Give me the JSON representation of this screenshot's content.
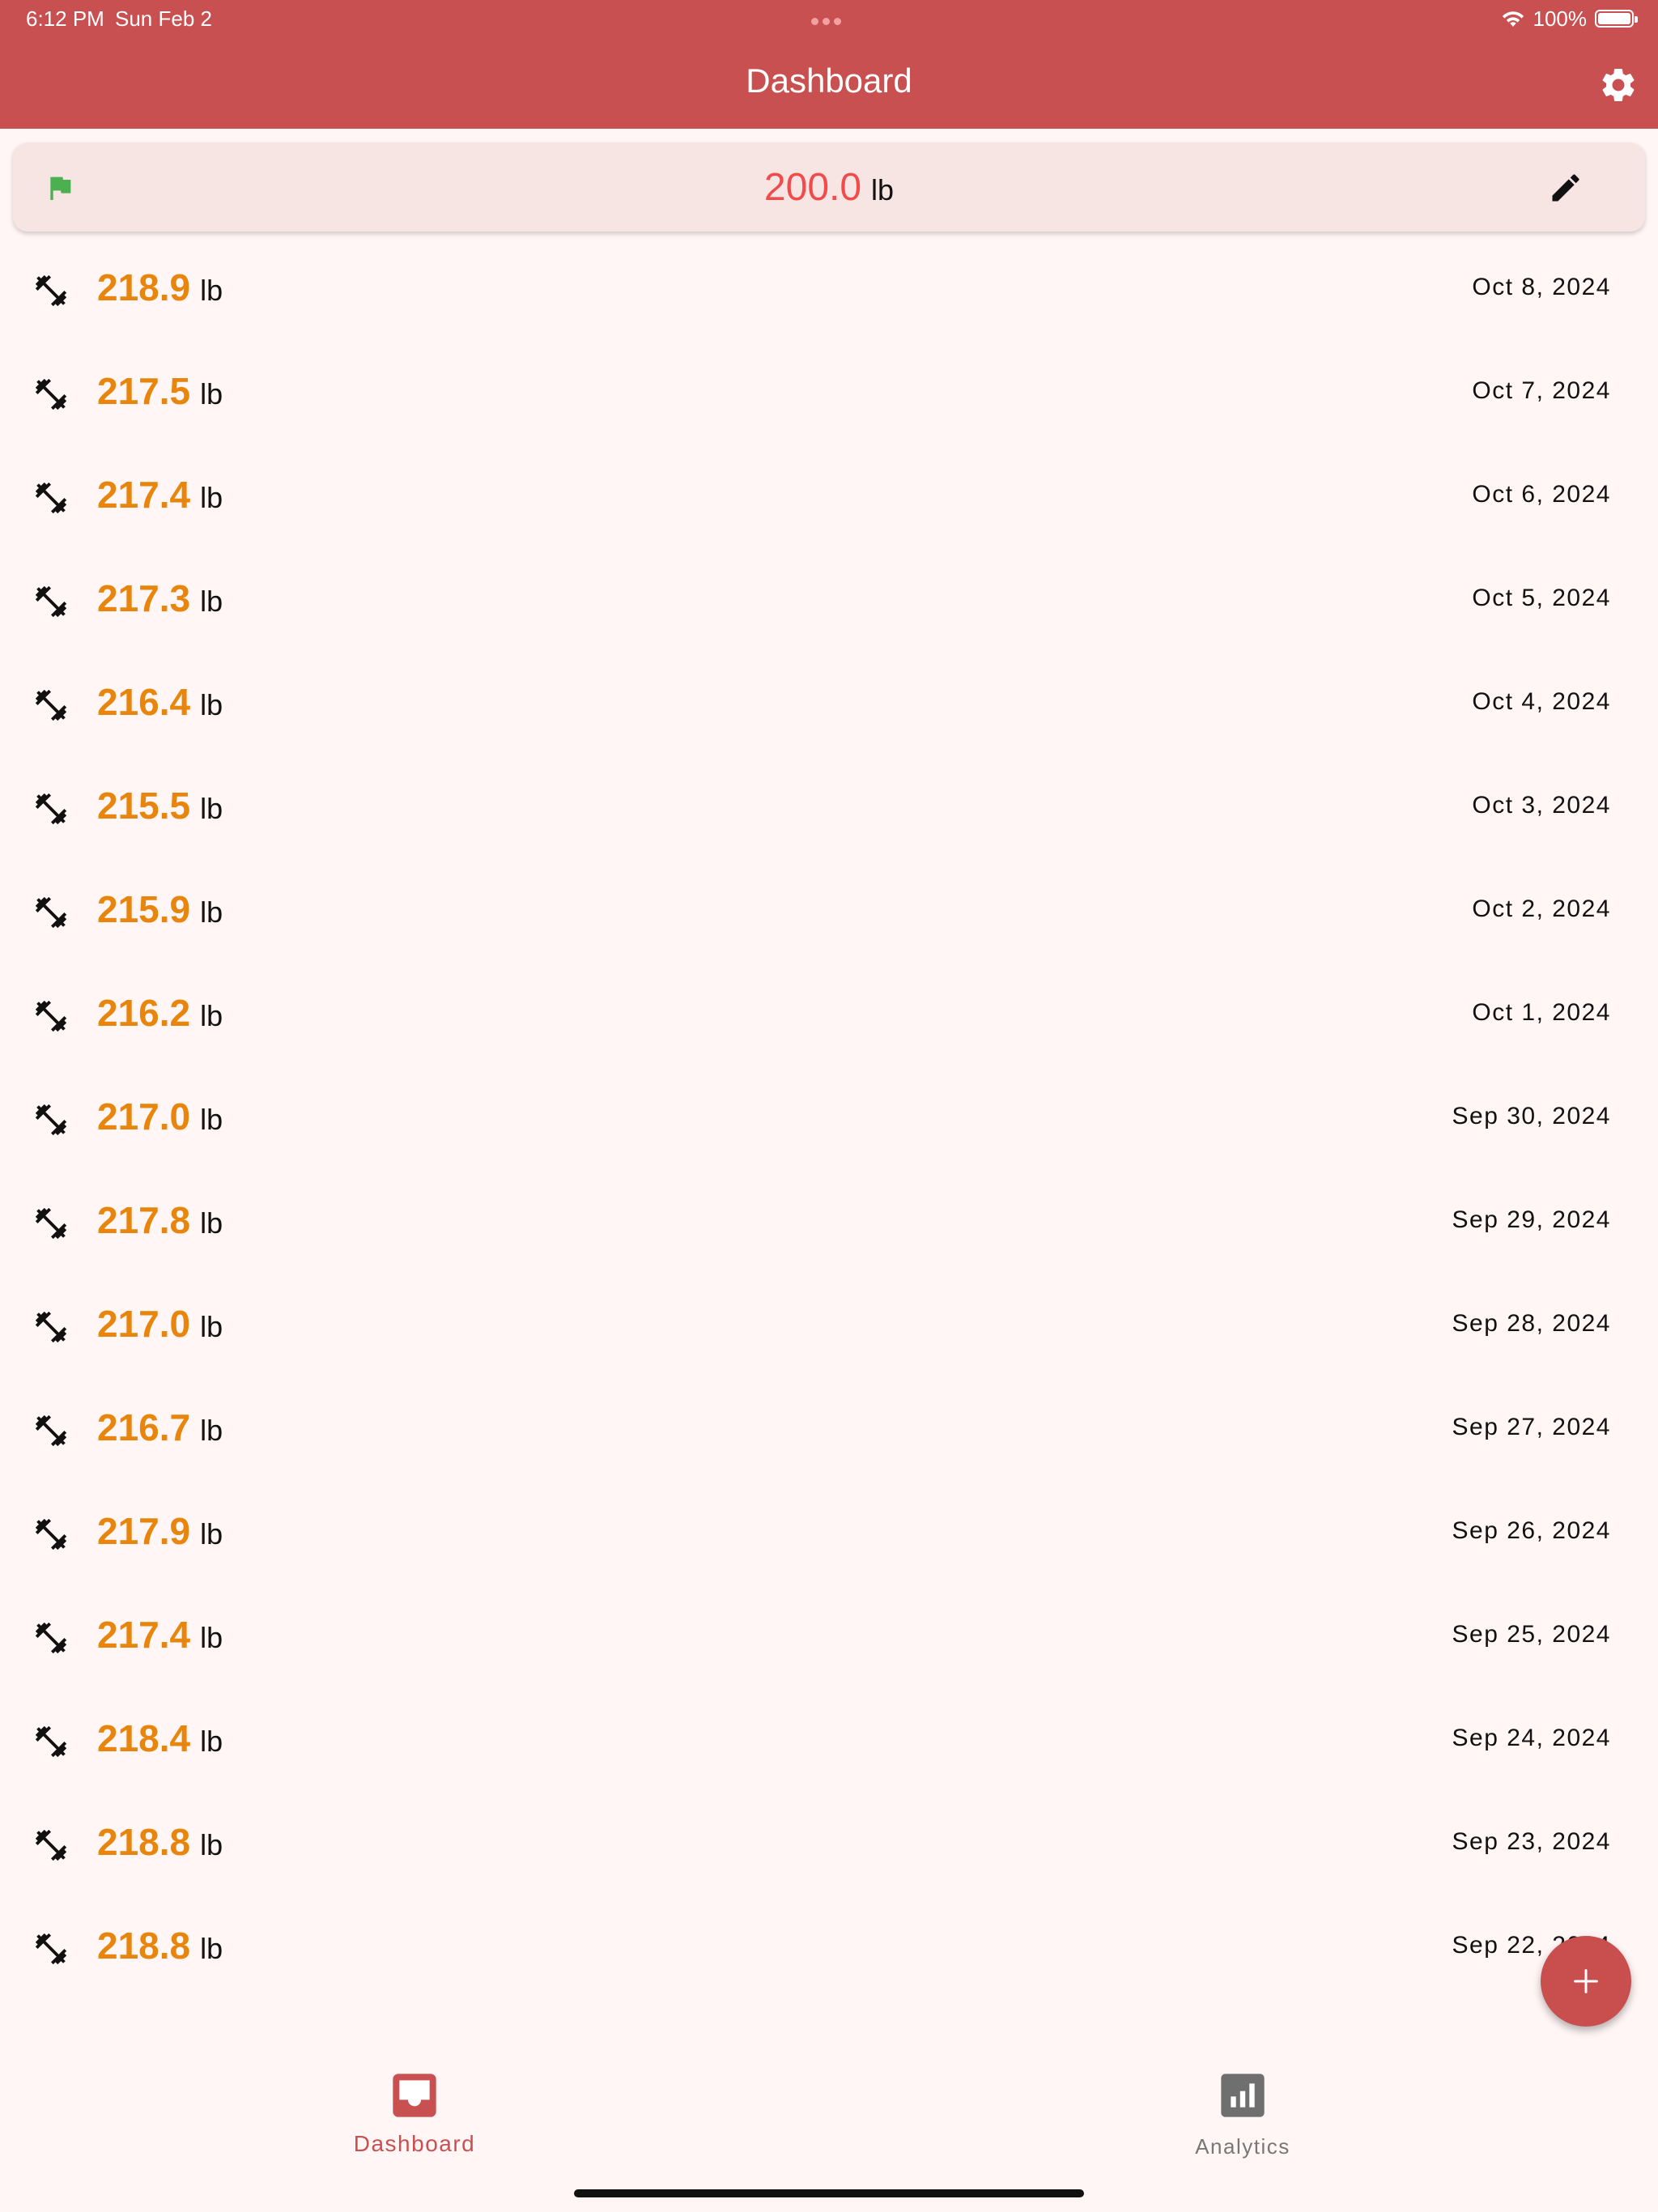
{
  "status_bar": {
    "time": "6:12 PM",
    "date": "Sun Feb 2",
    "battery": "100%"
  },
  "header": {
    "title": "Dashboard"
  },
  "goal": {
    "value": "200.0",
    "unit": "lb"
  },
  "entries": [
    {
      "weight": "218.9",
      "unit": "lb",
      "date": "Oct 8, 2024"
    },
    {
      "weight": "217.5",
      "unit": "lb",
      "date": "Oct 7, 2024"
    },
    {
      "weight": "217.4",
      "unit": "lb",
      "date": "Oct 6, 2024"
    },
    {
      "weight": "217.3",
      "unit": "lb",
      "date": "Oct 5, 2024"
    },
    {
      "weight": "216.4",
      "unit": "lb",
      "date": "Oct 4, 2024"
    },
    {
      "weight": "215.5",
      "unit": "lb",
      "date": "Oct 3, 2024"
    },
    {
      "weight": "215.9",
      "unit": "lb",
      "date": "Oct 2, 2024"
    },
    {
      "weight": "216.2",
      "unit": "lb",
      "date": "Oct 1, 2024"
    },
    {
      "weight": "217.0",
      "unit": "lb",
      "date": "Sep 30, 2024"
    },
    {
      "weight": "217.8",
      "unit": "lb",
      "date": "Sep 29, 2024"
    },
    {
      "weight": "217.0",
      "unit": "lb",
      "date": "Sep 28, 2024"
    },
    {
      "weight": "216.7",
      "unit": "lb",
      "date": "Sep 27, 2024"
    },
    {
      "weight": "217.9",
      "unit": "lb",
      "date": "Sep 26, 2024"
    },
    {
      "weight": "217.4",
      "unit": "lb",
      "date": "Sep 25, 2024"
    },
    {
      "weight": "218.4",
      "unit": "lb",
      "date": "Sep 24, 2024"
    },
    {
      "weight": "218.8",
      "unit": "lb",
      "date": "Sep 23, 2024"
    },
    {
      "weight": "218.8",
      "unit": "lb",
      "date": "Sep 22, 2024"
    }
  ],
  "bottom_nav": {
    "dashboard_label": "Dashboard",
    "analytics_label": "Analytics"
  },
  "colors": {
    "accent": "#c85050",
    "weight": "#e8850c",
    "goal": "#f24b4b",
    "flag": "#4caf50"
  },
  "icons": {
    "entry": "fitness-dumbbell-icon",
    "goal": "flag-icon",
    "edit": "pencil-icon",
    "settings": "gear-icon",
    "add": "plus-icon",
    "dashboard": "inbox-icon",
    "analytics": "bar-chart-icon"
  }
}
